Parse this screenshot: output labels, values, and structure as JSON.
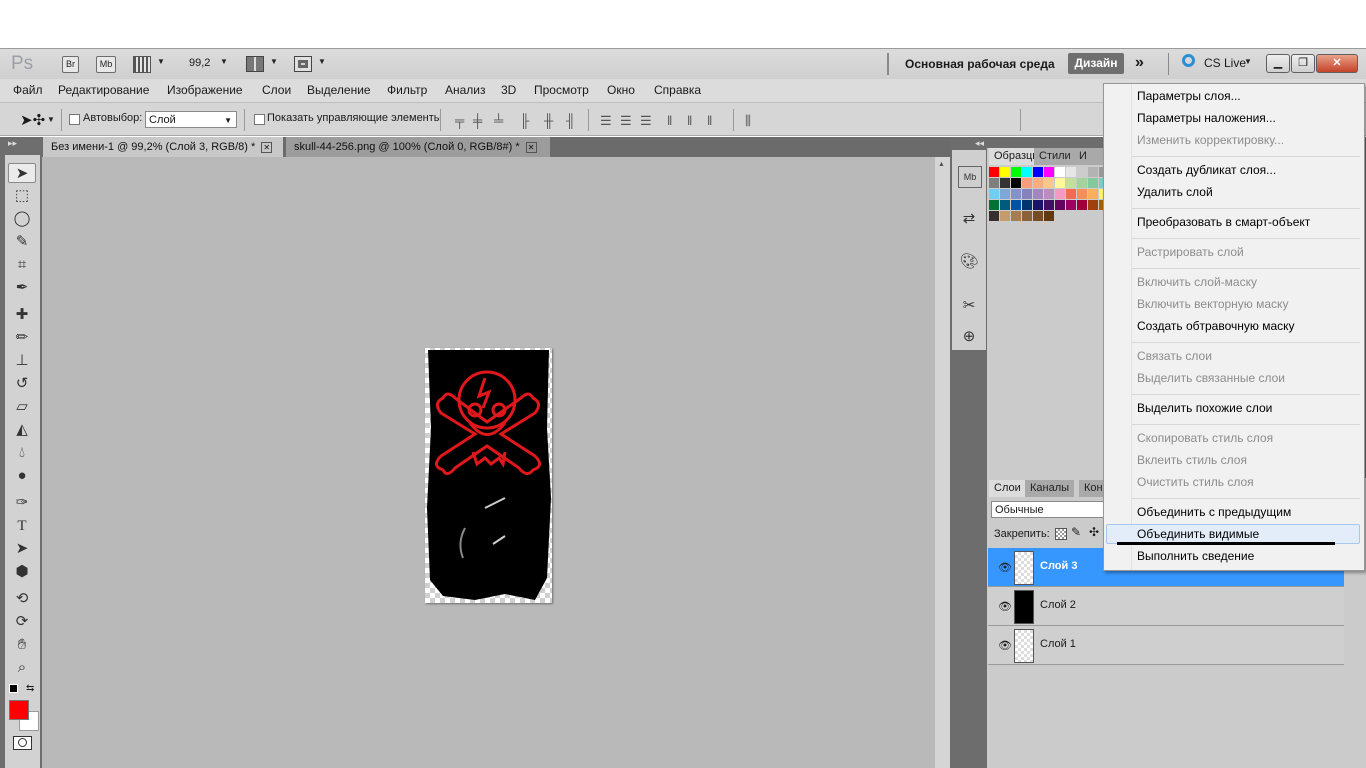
{
  "appbar": {
    "logo": "Ps",
    "br_label": "Br",
    "mb_label": "Mb",
    "zoom_value": "99,2",
    "workspace_title": "Основная рабочая среда",
    "workspace_button": "Дизайн",
    "more_icon": "»",
    "cslive_label": "CS Live",
    "win_buttons": [
      "minimize-icon",
      "restore-icon",
      "close-icon"
    ]
  },
  "menubar": {
    "items": [
      "Файл",
      "Редактирование",
      "Изображение",
      "Слои",
      "Выделение",
      "Фильтр",
      "Анализ",
      "3D",
      "Просмотр",
      "Окно",
      "Справка"
    ]
  },
  "options": {
    "autoselect_label": "Автовыбор:",
    "autoselect_value": "Слой",
    "show_controls_label": "Показать управляющие элементы"
  },
  "tabs": [
    {
      "label": "Без имени-1 @ 99,2% (Слой 3, RGB/8) *",
      "active": true
    },
    {
      "label": "skull-44-256.png @ 100% (Слой 0, RGB/8#) *",
      "active": false
    }
  ],
  "swatches_panel": {
    "tabs": [
      "Образцы",
      "Стили",
      "И"
    ],
    "colors": [
      "#ff0000",
      "#ffff00",
      "#00ff00",
      "#00ffff",
      "#0000ff",
      "#ff00ff",
      "#ffffff",
      "#e6e6e6",
      "#cccccc",
      "#b3b3b3",
      "#999999",
      "#7f7f7f",
      "#333333",
      "#000000",
      "#f79c7c",
      "#f9ad81",
      "#fdc68a",
      "#fff79a",
      "#c4df9b",
      "#a3d39c",
      "#82ca9c",
      "#7accc8",
      "#6dcff6",
      "#7da7d9",
      "#8393ca",
      "#8781bd",
      "#a187be",
      "#bd8cbf",
      "#f49ac2",
      "#f26c4f",
      "#f68e55",
      "#fbaf5c",
      "#fff467",
      "#007236",
      "#005b7f",
      "#0054a6",
      "#003471",
      "#1b1464",
      "#440e62",
      "#630460",
      "#9e005d",
      "#9e0039",
      "#a0410d",
      "#a36209",
      "#362f2d",
      "#c69c6d",
      "#a67c52",
      "#8c6239",
      "#754c24",
      "#603913"
    ]
  },
  "layers_panel": {
    "tabs": [
      "Слои",
      "Каналы",
      "Кон"
    ],
    "blend_mode": "Обычные",
    "lock_label": "Закрепить:",
    "layers": [
      {
        "name": "Слой 3",
        "selected": true,
        "thumb": "checker"
      },
      {
        "name": "Слой 2",
        "selected": false,
        "thumb": "dark"
      },
      {
        "name": "Слой 1",
        "selected": false,
        "thumb": "checker"
      }
    ]
  },
  "context_menu": {
    "items": [
      {
        "label": "Параметры слоя...",
        "disabled": false
      },
      {
        "label": "Параметры наложения...",
        "disabled": false
      },
      {
        "label": "Изменить корректировку...",
        "disabled": true
      },
      {
        "label": "Создать дубликат слоя...",
        "disabled": false
      },
      {
        "label": "Удалить слой",
        "disabled": false
      },
      {
        "label": "Преобразовать в смарт-объект",
        "disabled": false
      },
      {
        "label": "Растрировать слой",
        "disabled": true
      },
      {
        "label": "Включить слой-маску",
        "disabled": true
      },
      {
        "label": "Включить векторную маску",
        "disabled": true
      },
      {
        "label": "Создать обтравочную маску",
        "disabled": false
      },
      {
        "label": "Связать слои",
        "disabled": true
      },
      {
        "label": "Выделить связанные слои",
        "disabled": true
      },
      {
        "label": "Выделить похожие слои",
        "disabled": false
      },
      {
        "label": "Скопировать стиль слоя",
        "disabled": true
      },
      {
        "label": "Вклеить стиль слоя",
        "disabled": true
      },
      {
        "label": "Очистить стиль слоя",
        "disabled": true
      },
      {
        "label": "Объединить с предыдущим",
        "disabled": false
      },
      {
        "label": "Объединить видимые",
        "disabled": false,
        "highlighted": true
      },
      {
        "label": "Выполнить сведение",
        "disabled": false
      }
    ]
  },
  "colors": {
    "foreground": "#ff0000",
    "background": "#ffffff",
    "selection": "#3597ff",
    "skull_line": "#e0181c"
  }
}
